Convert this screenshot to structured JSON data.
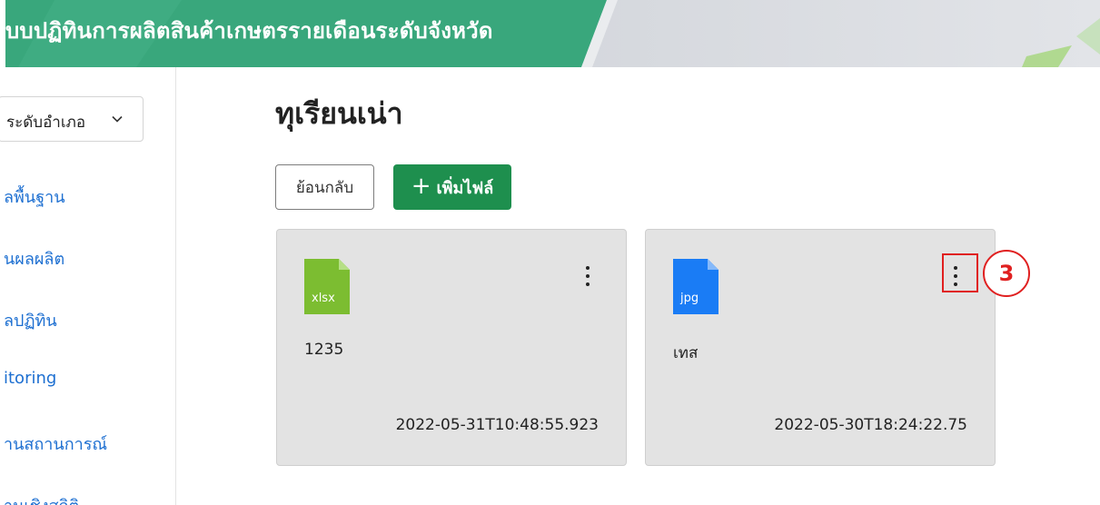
{
  "header": {
    "title": "บบปฏิทินการผลิตสินค้าเกษตรรายเดือนระดับจังหวัด"
  },
  "sidebar": {
    "level_select_value": "ระดับอำเภอ",
    "items": [
      {
        "label": "ลพื้นฐาน"
      },
      {
        "label": "นผลผลิต"
      },
      {
        "label": "ลปฏิทิน"
      },
      {
        "label": "itoring"
      },
      {
        "label": "านสถานการณ์"
      },
      {
        "label": "านเชิงสถิติ"
      }
    ]
  },
  "main": {
    "title": "ทุเรียนเน่า",
    "back_label": "ย้อนกลับ",
    "add_label": "เพิ่มไฟล์",
    "add_icon": "plus-icon"
  },
  "files": [
    {
      "ext": "xlsx",
      "name": "1235",
      "date": "2022-05-31T10:48:55.923",
      "color": "#7cbd31",
      "menu_icon": "kebab-menu-icon"
    },
    {
      "ext": "jpg",
      "name": "เทส",
      "date": "2022-05-30T18:24:22.75",
      "color": "#1a7cf5",
      "menu_icon": "kebab-menu-icon"
    }
  ],
  "annotation": {
    "step": "3",
    "color": "#e02020"
  },
  "colors": {
    "brand_green": "#1e8f4e",
    "header_green": "#3aa57b",
    "link_blue": "#1d6fd1"
  }
}
